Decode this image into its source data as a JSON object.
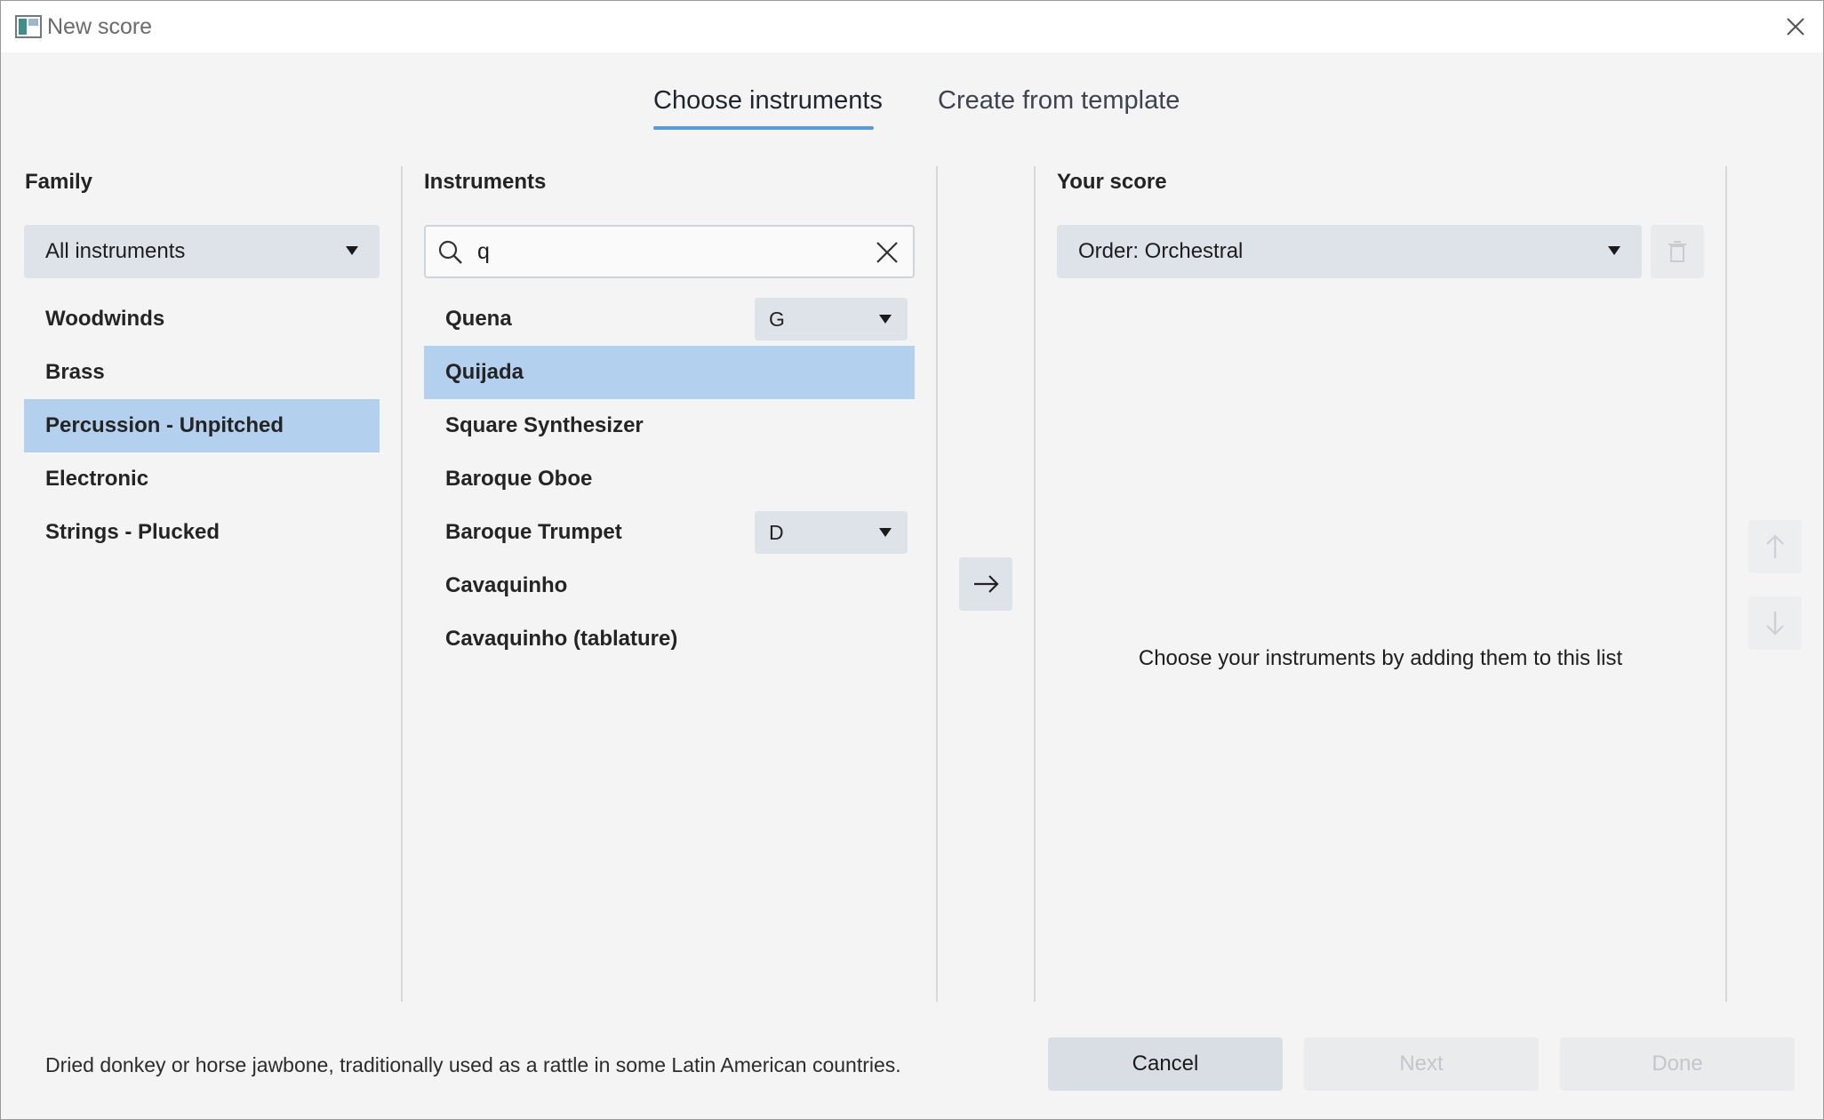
{
  "window": {
    "title": "New score"
  },
  "tabs": [
    {
      "label": "Choose instruments",
      "active": true
    },
    {
      "label": "Create from template",
      "active": false
    }
  ],
  "family": {
    "title": "Family",
    "dropdown_value": "All instruments",
    "items": [
      {
        "label": "Woodwinds",
        "selected": false
      },
      {
        "label": "Brass",
        "selected": false
      },
      {
        "label": "Percussion - Unpitched",
        "selected": true
      },
      {
        "label": "Electronic",
        "selected": false
      },
      {
        "label": "Strings - Plucked",
        "selected": false
      }
    ]
  },
  "instruments": {
    "title": "Instruments",
    "search_value": "q",
    "items": [
      {
        "label": "Quena",
        "selected": false,
        "transposition": "G"
      },
      {
        "label": "Quijada",
        "selected": true,
        "transposition": ""
      },
      {
        "label": "Square Synthesizer",
        "selected": false,
        "transposition": ""
      },
      {
        "label": "Baroque Oboe",
        "selected": false,
        "transposition": ""
      },
      {
        "label": "Baroque Trumpet",
        "selected": false,
        "transposition": "D"
      },
      {
        "label": "Cavaquinho",
        "selected": false,
        "transposition": ""
      },
      {
        "label": "Cavaquinho (tablature)",
        "selected": false,
        "transposition": ""
      }
    ]
  },
  "your_score": {
    "title": "Your score",
    "order_value": "Order: Orchestral",
    "empty_message": "Choose your instruments by adding them to this list"
  },
  "footer": {
    "description": "Dried donkey or horse jawbone, traditionally used as a rattle in some Latin American countries.",
    "cancel_label": "Cancel",
    "next_label": "Next",
    "done_label": "Done"
  },
  "colors": {
    "selection": "#b3d1ef",
    "accent": "#5b9bd5",
    "control_bg": "#dee3e9"
  },
  "icons": {
    "app": "musescore-app-icon",
    "close": "close-icon",
    "search": "search-icon",
    "clear": "clear-icon",
    "add": "arrow-right-icon",
    "delete": "trash-icon",
    "up": "arrow-up-icon",
    "down": "arrow-down-icon"
  }
}
